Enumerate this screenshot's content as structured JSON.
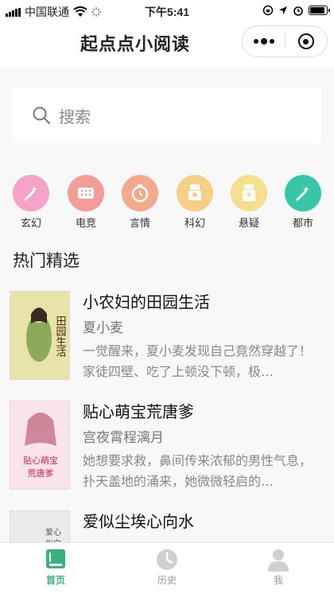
{
  "status_bar": {
    "carrier": "中国联通",
    "time": "下午5:41",
    "battery_level": 0.9
  },
  "nav": {
    "title": "起点点小阅读"
  },
  "search": {
    "placeholder": "搜索"
  },
  "categories": [
    {
      "label": "玄幻",
      "icon": "magic-wand-icon",
      "color": "#f7a3c7"
    },
    {
      "label": "电竞",
      "icon": "game-icon",
      "color": "#f29d95"
    },
    {
      "label": "言情",
      "icon": "heart-clock-icon",
      "color": "#f4a98a"
    },
    {
      "label": "科幻",
      "icon": "robot-icon",
      "color": "#f7cf86"
    },
    {
      "label": "悬疑",
      "icon": "detective-icon",
      "color": "#f5df8e"
    },
    {
      "label": "都市",
      "icon": "magic-wand-icon",
      "color": "#37c6aa"
    }
  ],
  "section": {
    "title": "热门精选"
  },
  "books": [
    {
      "title": "小农妇的田园生活",
      "author": "夏小麦",
      "desc": "一觉醒来，夏小麦发现自己竟然穿越了！家徒四壁、吃了上顿没下顿，极…",
      "cover_text": "田园生活",
      "cover_colors": [
        "#e8e3a8",
        "#9cb36a"
      ]
    },
    {
      "title": "贴心萌宝荒唐爹",
      "author": "宫夜霄程漓月",
      "desc": "她想要求救，鼻间传来浓郁的男性气息，扑天盖地的涌来，她微微轻启的…",
      "cover_text": "贴心萌宝荒唐爹",
      "cover_colors": [
        "#fbe3ea",
        "#f2a6bd"
      ]
    },
    {
      "title": "爱似尘埃心向水",
      "author": "",
      "desc": "",
      "cover_text": "爱心似向",
      "cover_colors": [
        "#e9ece9",
        "#c9cfc9"
      ]
    }
  ],
  "tabs": [
    {
      "label": "首页",
      "icon": "book-icon",
      "active": true
    },
    {
      "label": "历史",
      "icon": "clock-icon",
      "active": false
    },
    {
      "label": "我",
      "icon": "user-icon",
      "active": false
    }
  ]
}
